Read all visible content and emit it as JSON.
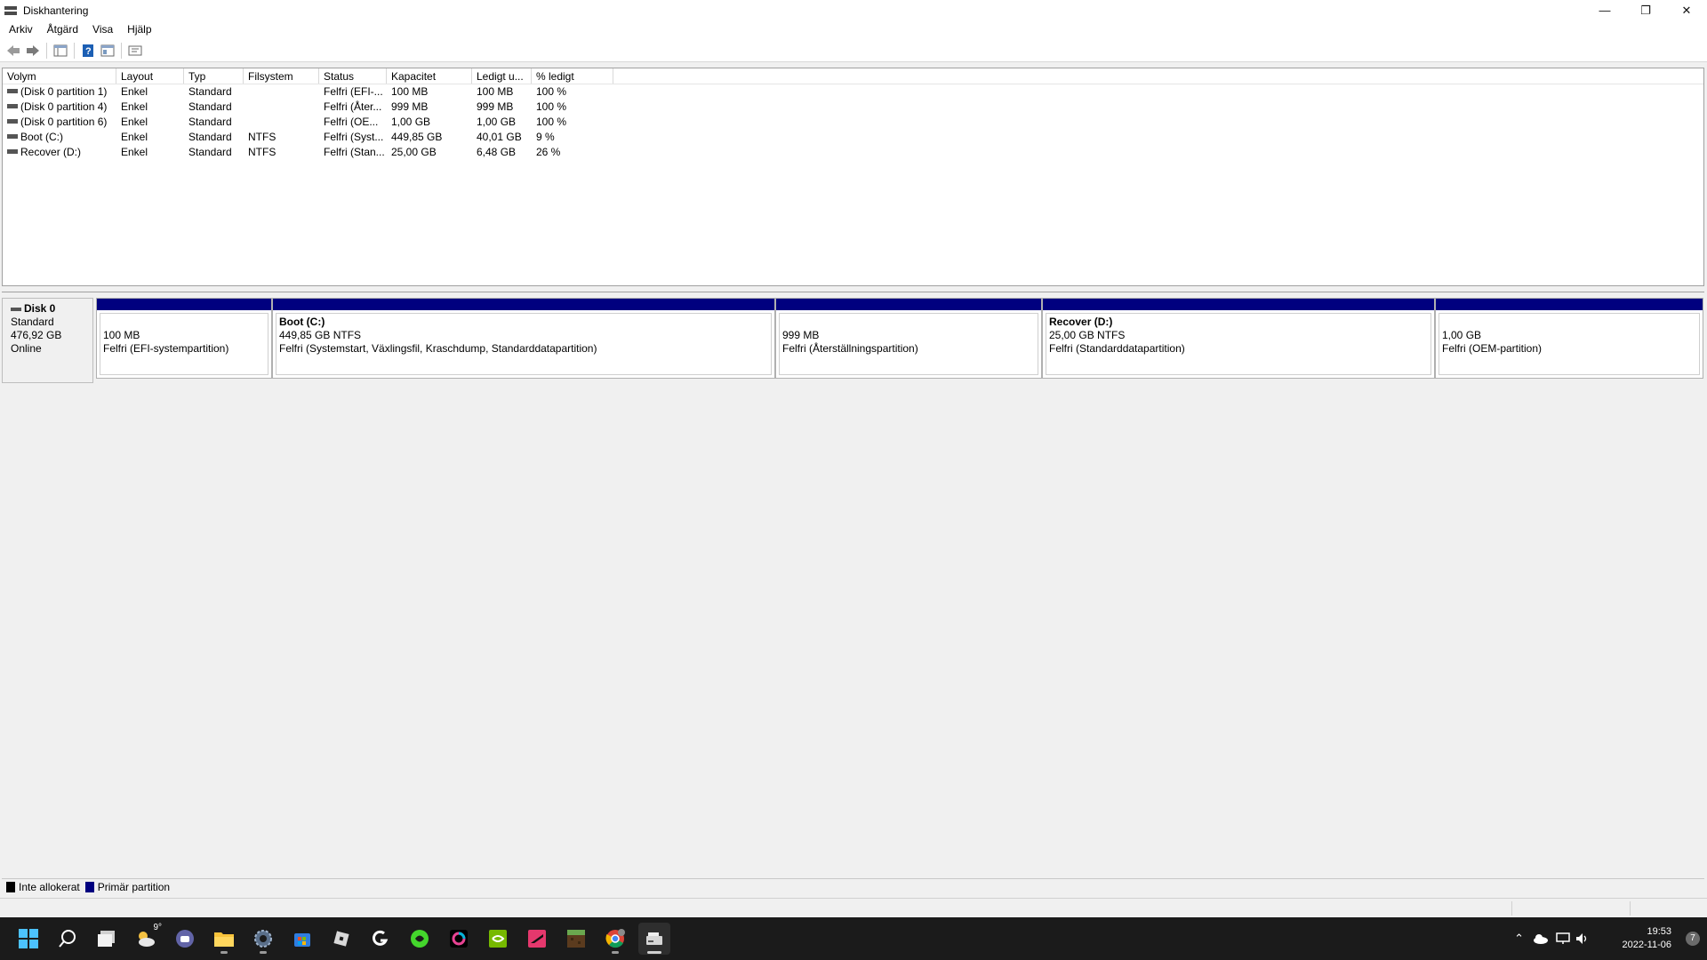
{
  "window": {
    "title": "Diskhantering",
    "minimize": "—",
    "restore": "❐",
    "close": "✕"
  },
  "menu": [
    "Arkiv",
    "Åtgärd",
    "Visa",
    "Hjälp"
  ],
  "volume_table": {
    "columns": [
      "Volym",
      "Layout",
      "Typ",
      "Filsystem",
      "Status",
      "Kapacitet",
      "Ledigt u...",
      "% ledigt"
    ],
    "rows": [
      [
        "(Disk 0 partition 1)",
        "Enkel",
        "Standard",
        "",
        "Felfri (EFI-...",
        "100 MB",
        "100 MB",
        "100 %"
      ],
      [
        "(Disk 0 partition 4)",
        "Enkel",
        "Standard",
        "",
        "Felfri (Åter...",
        "999 MB",
        "999 MB",
        "100 %"
      ],
      [
        "(Disk 0 partition 6)",
        "Enkel",
        "Standard",
        "",
        "Felfri (OE...",
        "1,00 GB",
        "1,00 GB",
        "100 %"
      ],
      [
        "Boot (C:)",
        "Enkel",
        "Standard",
        "NTFS",
        "Felfri (Syst...",
        "449,85 GB",
        "40,01 GB",
        "9 %"
      ],
      [
        "Recover (D:)",
        "Enkel",
        "Standard",
        "NTFS",
        "Felfri (Stan...",
        "25,00 GB",
        "6,48 GB",
        "26 %"
      ]
    ]
  },
  "disk": {
    "name": "Disk 0",
    "type": "Standard",
    "size": "476,92 GB",
    "state": "Online",
    "partitions": [
      {
        "name": "",
        "size": "100 MB",
        "status": "Felfri (EFI-systempartition)"
      },
      {
        "name": "Boot  (C:)",
        "size": "449,85 GB NTFS",
        "status": "Felfri (Systemstart, Växlingsfil, Kraschdump, Standarddatapartition)"
      },
      {
        "name": "",
        "size": "999 MB",
        "status": "Felfri (Återställningspartition)"
      },
      {
        "name": "Recover  (D:)",
        "size": "25,00 GB NTFS",
        "status": "Felfri (Standarddatapartition)"
      },
      {
        "name": "",
        "size": "1,00 GB",
        "status": "Felfri (OEM-partition)"
      }
    ]
  },
  "legend": [
    {
      "label": "Inte allokerat",
      "color": "#000000"
    },
    {
      "label": "Primär partition",
      "color": "#00007f"
    }
  ],
  "taskbar": {
    "weather_temp": "9°",
    "clock_time": "19:53",
    "clock_date": "2022-11-06",
    "notification_count": "7",
    "apps": [
      "start-icon",
      "search-icon",
      "task-view-icon",
      "weather-icon",
      "teams-chat-icon",
      "file-explorer-icon",
      "settings-icon",
      "store-icon",
      "roblox-icon",
      "logitech-g-icon",
      "razer-icon",
      "color-ring-icon",
      "nvidia-icon",
      "racing-game-icon",
      "minecraft-icon",
      "chrome-icon",
      "disk-management-icon"
    ]
  },
  "colors": {
    "primary_partition": "#00007f",
    "taskbar": "#1b1b1b"
  }
}
